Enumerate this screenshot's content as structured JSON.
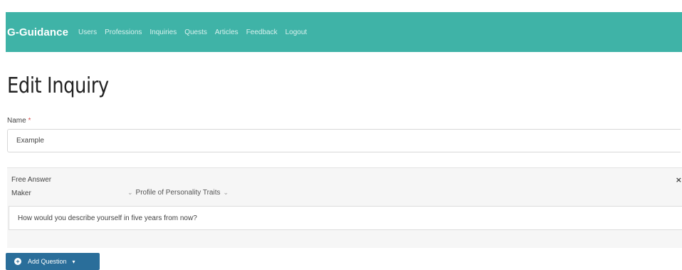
{
  "navbar": {
    "brand": "G-Guidance",
    "links": [
      "Users",
      "Professions",
      "Inquiries",
      "Quests",
      "Articles",
      "Feedback",
      "Logout"
    ]
  },
  "page": {
    "title": "Edit Inquiry"
  },
  "form": {
    "name_label": "Name",
    "required_mark": "*",
    "name_value": "Example"
  },
  "question": {
    "type": "Free Answer",
    "close_glyph": "×",
    "category": "Maker",
    "trait": "Profile of Personality Traits",
    "text": "How would you describe yourself in five years from now?"
  },
  "actions": {
    "add_question_label": "Add Question"
  },
  "colors": {
    "navbar": "#3fb3a7",
    "button": "#2a6e9a",
    "required": "#d9534f"
  }
}
